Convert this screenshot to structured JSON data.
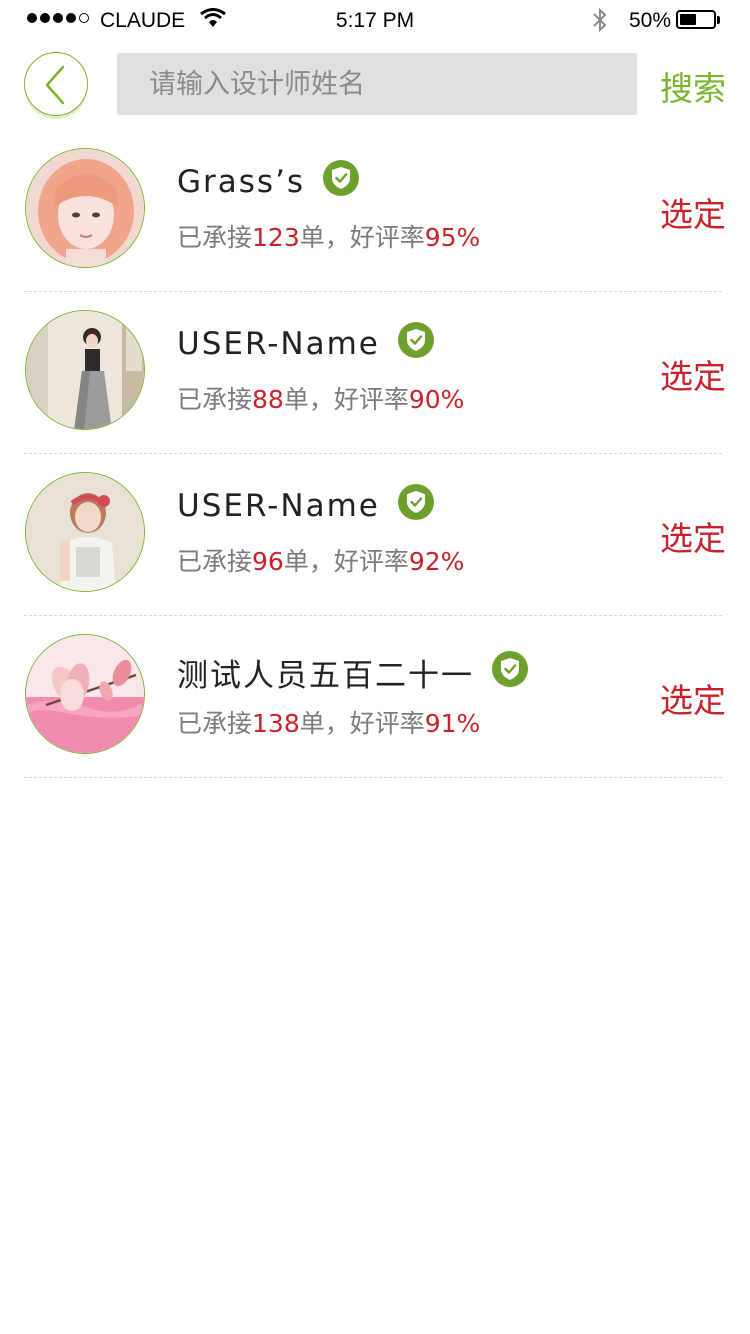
{
  "status_bar": {
    "carrier": "CLAUDE",
    "time": "5:17 PM",
    "battery_percent": "50%",
    "battery_level": 0.5,
    "signal_bars": 4
  },
  "header": {
    "back_icon": "chevron-left-icon",
    "search_placeholder": "请输入设计师姓名",
    "search_value": "",
    "search_label": "搜索"
  },
  "colors": {
    "accent_green": "#7ab530",
    "highlight_red": "#c8232c",
    "text_gray": "#7b7b7b",
    "input_bg": "#e0e0e0"
  },
  "designers": [
    {
      "name": "Grass’s",
      "verified_icon": "shield-check-icon",
      "stats_prefix": "已承接",
      "orders": "123",
      "orders_unit": "单，好评率",
      "rating": "95%",
      "select_label": "选定",
      "avatar": "avatar-pink-hair"
    },
    {
      "name": "USER-Name",
      "verified_icon": "shield-check-icon",
      "stats_prefix": "已承接",
      "orders": "88",
      "orders_unit": "单，好评率",
      "rating": "90%",
      "select_label": "选定",
      "avatar": "avatar-dress"
    },
    {
      "name": "USER-Name",
      "verified_icon": "shield-check-icon",
      "stats_prefix": "已承接",
      "orders": "96",
      "orders_unit": "单，好评率",
      "rating": "92%",
      "select_label": "选定",
      "avatar": "avatar-headband"
    },
    {
      "name": "测试人员五百二十一",
      "verified_icon": "shield-check-icon",
      "stats_prefix": "已承接",
      "orders": "138",
      "orders_unit": "单，好评率",
      "rating": "91%",
      "select_label": "选定",
      "avatar": "avatar-magnolia"
    }
  ]
}
